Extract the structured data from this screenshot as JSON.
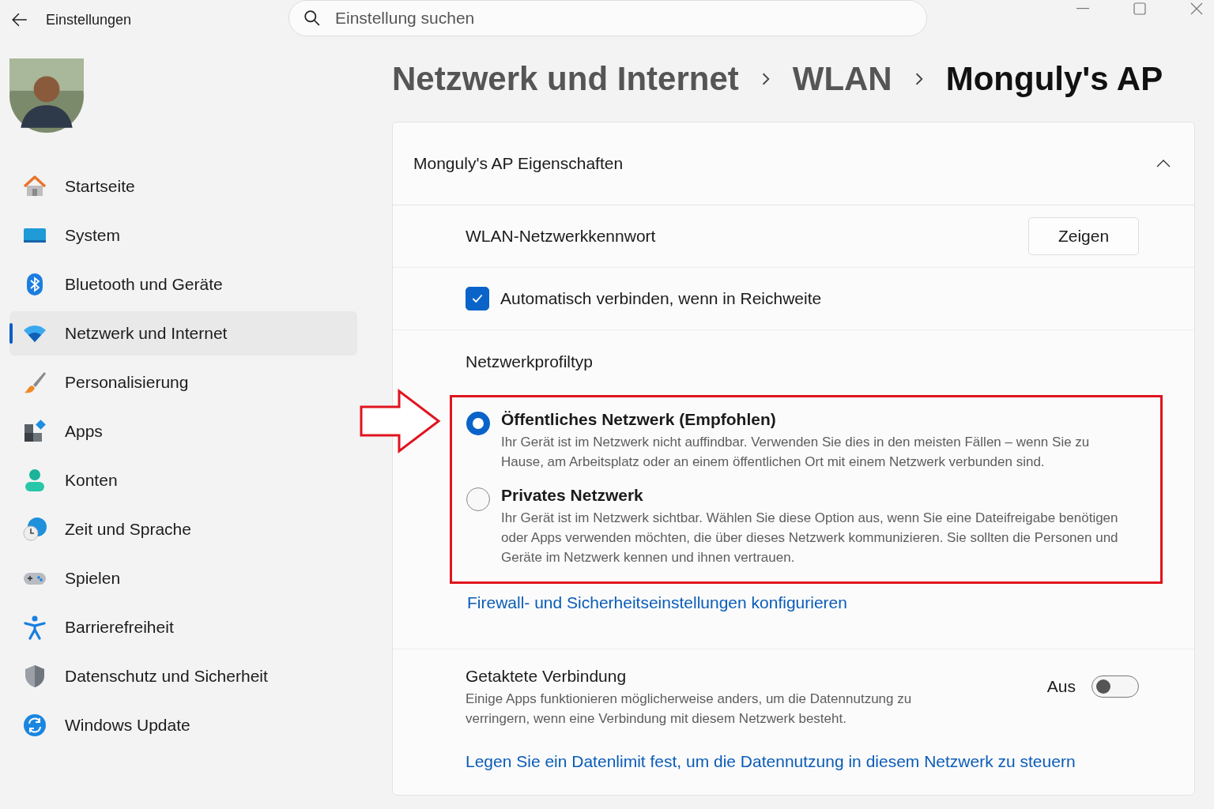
{
  "window": {
    "title": "Einstellungen"
  },
  "search": {
    "placeholder": "Einstellung suchen"
  },
  "sidebar": {
    "items": [
      {
        "label": "Startseite",
        "selected": false
      },
      {
        "label": "System",
        "selected": false
      },
      {
        "label": "Bluetooth und Geräte",
        "selected": false
      },
      {
        "label": "Netzwerk und Internet",
        "selected": true
      },
      {
        "label": "Personalisierung",
        "selected": false
      },
      {
        "label": "Apps",
        "selected": false
      },
      {
        "label": "Konten",
        "selected": false
      },
      {
        "label": "Zeit und Sprache",
        "selected": false
      },
      {
        "label": "Spielen",
        "selected": false
      },
      {
        "label": "Barrierefreiheit",
        "selected": false
      },
      {
        "label": "Datenschutz und Sicherheit",
        "selected": false
      },
      {
        "label": "Windows Update",
        "selected": false
      }
    ]
  },
  "breadcrumb": [
    {
      "label": "Netzwerk und Internet",
      "selected": false
    },
    {
      "label": "WLAN",
      "selected": false
    },
    {
      "label": "Monguly's AP",
      "selected": true
    }
  ],
  "card": {
    "title": "Monguly's AP Eigenschaften",
    "expanded": true,
    "password": {
      "label": "WLAN-Netzwerkkennwort",
      "button": "Zeigen"
    },
    "auto_connect": {
      "label": "Automatisch verbinden, wenn in Reichweite",
      "checked": true
    },
    "profile": {
      "label": "Netzwerkprofiltyp",
      "options": [
        {
          "title": "Öffentliches Netzwerk (Empfohlen)",
          "description": "Ihr Gerät ist im Netzwerk nicht auffindbar. Verwenden Sie dies in den meisten Fällen – wenn Sie zu Hause, am Arbeitsplatz oder an einem öffentlichen Ort mit einem Netzwerk verbunden sind.",
          "selected": true
        },
        {
          "title": "Privates Netzwerk",
          "description": "Ihr Gerät ist im Netzwerk sichtbar. Wählen Sie diese Option aus, wenn Sie eine Dateifreigabe benötigen oder Apps verwenden möchten, die über dieses Netzwerk kommunizieren. Sie sollten die Personen und Geräte im Netzwerk kennen und ihnen vertrauen.",
          "selected": false
        }
      ]
    },
    "firewall_link": "Firewall- und Sicherheitseinstellungen konfigurieren",
    "metered": {
      "title": "Getaktete Verbindung",
      "description": "Einige Apps funktionieren möglicherweise anders, um die Datennutzung zu verringern, wenn eine Verbindung mit diesem Netzwerk besteht.",
      "state_label": "Aus",
      "on": false
    },
    "data_limit_link": "Legen Sie ein Datenlimit fest, um die Datennutzung in diesem Netzwerk zu steuern"
  }
}
